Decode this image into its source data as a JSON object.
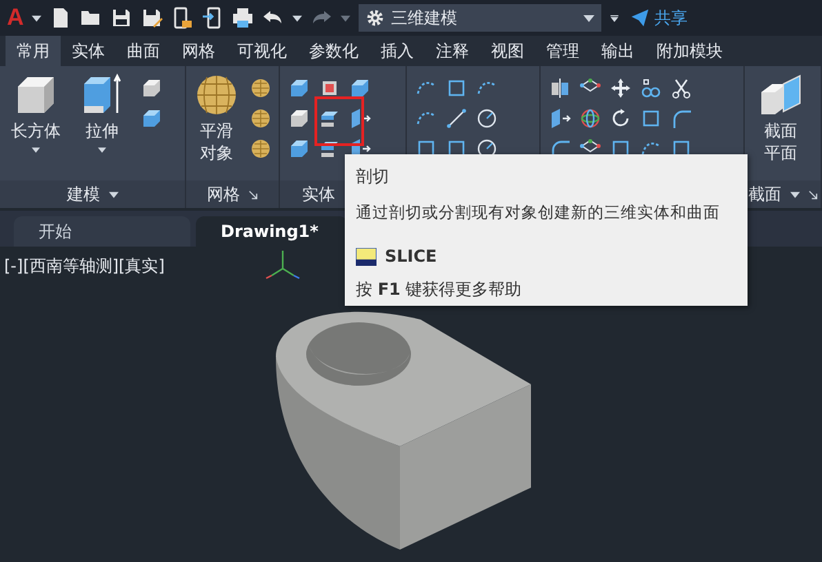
{
  "app_logo": "A",
  "workspace": {
    "value": "三维建模"
  },
  "share_button": "共享",
  "tabs": [
    {
      "label": "常用",
      "selected": true
    },
    {
      "label": "实体",
      "selected": false
    },
    {
      "label": "曲面",
      "selected": false
    },
    {
      "label": "网格",
      "selected": false
    },
    {
      "label": "可视化",
      "selected": false
    },
    {
      "label": "参数化",
      "selected": false
    },
    {
      "label": "插入",
      "selected": false
    },
    {
      "label": "注释",
      "selected": false
    },
    {
      "label": "视图",
      "selected": false
    },
    {
      "label": "管理",
      "selected": false
    },
    {
      "label": "输出",
      "selected": false
    },
    {
      "label": "附加模块",
      "selected": false
    }
  ],
  "ribbon_panels": [
    {
      "kind": "modeling",
      "label": "建模",
      "large_buttons": [
        "长方体",
        "拉伸"
      ]
    },
    {
      "kind": "mesh",
      "label": "网格",
      "large_buttons": [
        "平滑对象"
      ]
    },
    {
      "kind": "solid_editing",
      "label": "实体"
    },
    {
      "kind": "draw"
    },
    {
      "kind": "modify"
    },
    {
      "kind": "section",
      "label": "截面",
      "large_buttons": [
        "截面平面"
      ]
    }
  ],
  "document_tabs": [
    {
      "label": "开始",
      "selected": false
    },
    {
      "label": "Drawing1*",
      "selected": true
    }
  ],
  "viewport": {
    "label": "[-][西南等轴测][真实]"
  },
  "tooltip": {
    "title": "剖切",
    "description": "通过剖切或分割现有对象创建新的三维实体和曲面",
    "command": "SLICE",
    "help": "按 **F1** 键获得更多帮助"
  }
}
